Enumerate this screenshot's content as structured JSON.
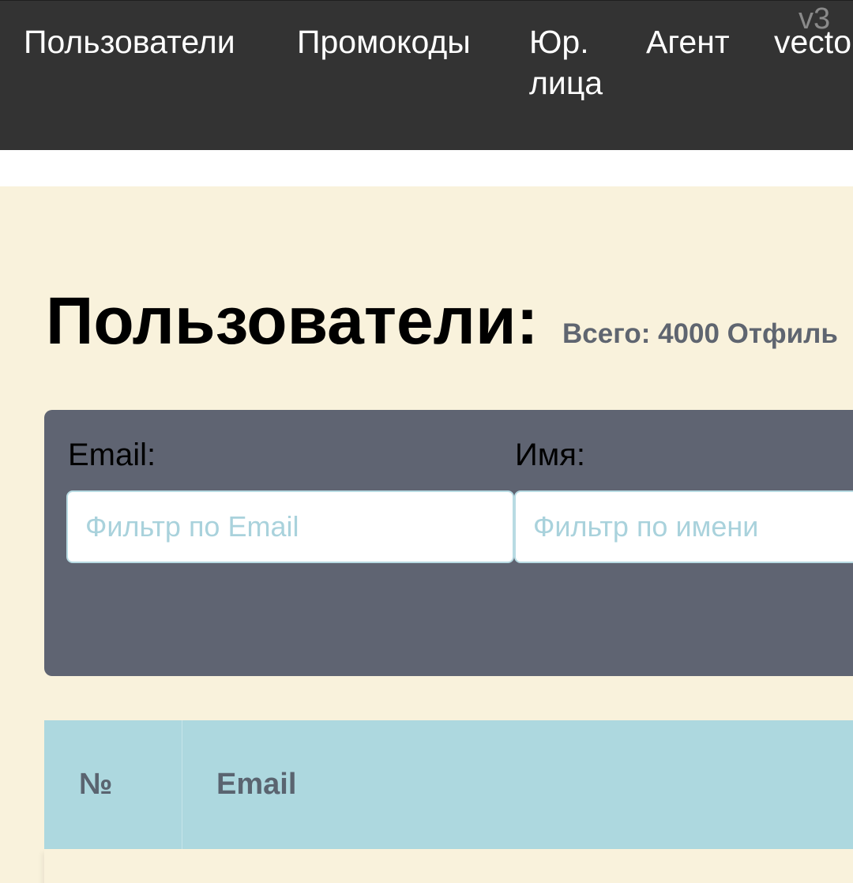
{
  "nav": {
    "items": [
      {
        "label": "Пользователи"
      },
      {
        "label": "Промокоды"
      },
      {
        "label": "Юр. лица"
      },
      {
        "label": "Агент"
      },
      {
        "label": "vecto"
      }
    ],
    "version": "v3"
  },
  "page": {
    "title": "Пользователи:",
    "summary": "Всего: 4000 Отфиль"
  },
  "filters": {
    "email": {
      "label": "Email:",
      "placeholder": "Фильтр по Email",
      "value": ""
    },
    "name": {
      "label": "Имя:",
      "placeholder": "Фильтр по имени",
      "value": ""
    }
  },
  "table": {
    "columns": [
      "№",
      "Email"
    ]
  },
  "colors": {
    "nav_bg": "#333333",
    "page_bg": "#f9f2dc",
    "filter_panel_bg": "#5f6472",
    "table_header_bg": "#add8df",
    "placeholder": "#a9d2dc"
  }
}
